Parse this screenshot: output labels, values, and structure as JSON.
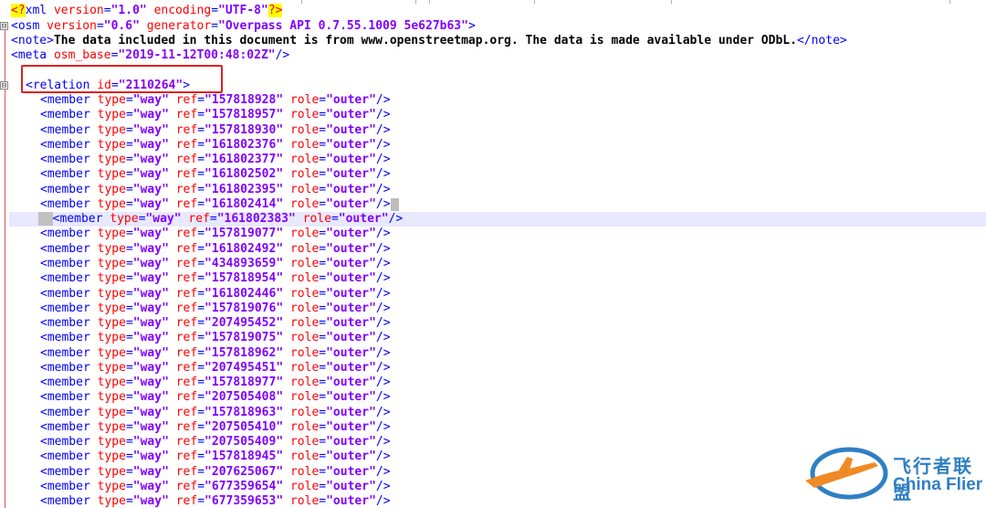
{
  "xml_decl": {
    "open": "<?",
    "name": "xml",
    "version_attr": "version",
    "version_val": "\"1.0\"",
    "encoding_attr": "encoding",
    "encoding_val": "\"UTF-8\"",
    "close": "?>"
  },
  "osm_line": {
    "tag": "<osm",
    "version_attr": "version",
    "version_val": "\"0.6\"",
    "generator_attr": "generator",
    "generator_val": "\"Overpass API 0.7.55.1009 5e627b63\"",
    "close": ">"
  },
  "note_line": {
    "open": "<note>",
    "text": "The data included in this document is from www.openstreetmap.org. The data is made available under ODbL.",
    "close": "</note>"
  },
  "meta_line": {
    "tag": "<meta",
    "attr": "osm_base",
    "val": "\"2019-11-12T00:48:02Z\"",
    "close": "/>"
  },
  "relation_line": {
    "tag": "<relation",
    "attr": "id",
    "val": "\"2110264\"",
    "close": ">"
  },
  "member": {
    "tag": "<member",
    "type_attr": "type",
    "type_val": "\"way\"",
    "ref_attr": "ref",
    "role_attr": "role",
    "role_val": "\"outer\"",
    "close": "/>"
  },
  "members": [
    "\"157818928\"",
    "\"157818957\"",
    "\"157818930\"",
    "\"161802376\"",
    "\"161802377\"",
    "\"161802502\"",
    "\"161802395\"",
    "\"161802414\"",
    "\"161802383\"",
    "\"157819077\"",
    "\"161802492\"",
    "\"434893659\"",
    "\"157818954\"",
    "\"161802446\"",
    "\"157819076\"",
    "\"207495452\"",
    "\"157819075\"",
    "\"157818962\"",
    "\"207495451\"",
    "\"157818977\"",
    "\"207505408\"",
    "\"157818963\"",
    "\"207505410\"",
    "\"207505409\"",
    "\"157818945\"",
    "\"207625067\"",
    "\"677359654\"",
    "\"677359653\""
  ],
  "selected_index": 8,
  "fold_markers": [
    "⊟",
    "⊟"
  ],
  "watermark": {
    "cn": "飞行者联盟",
    "en": "China Flier"
  }
}
